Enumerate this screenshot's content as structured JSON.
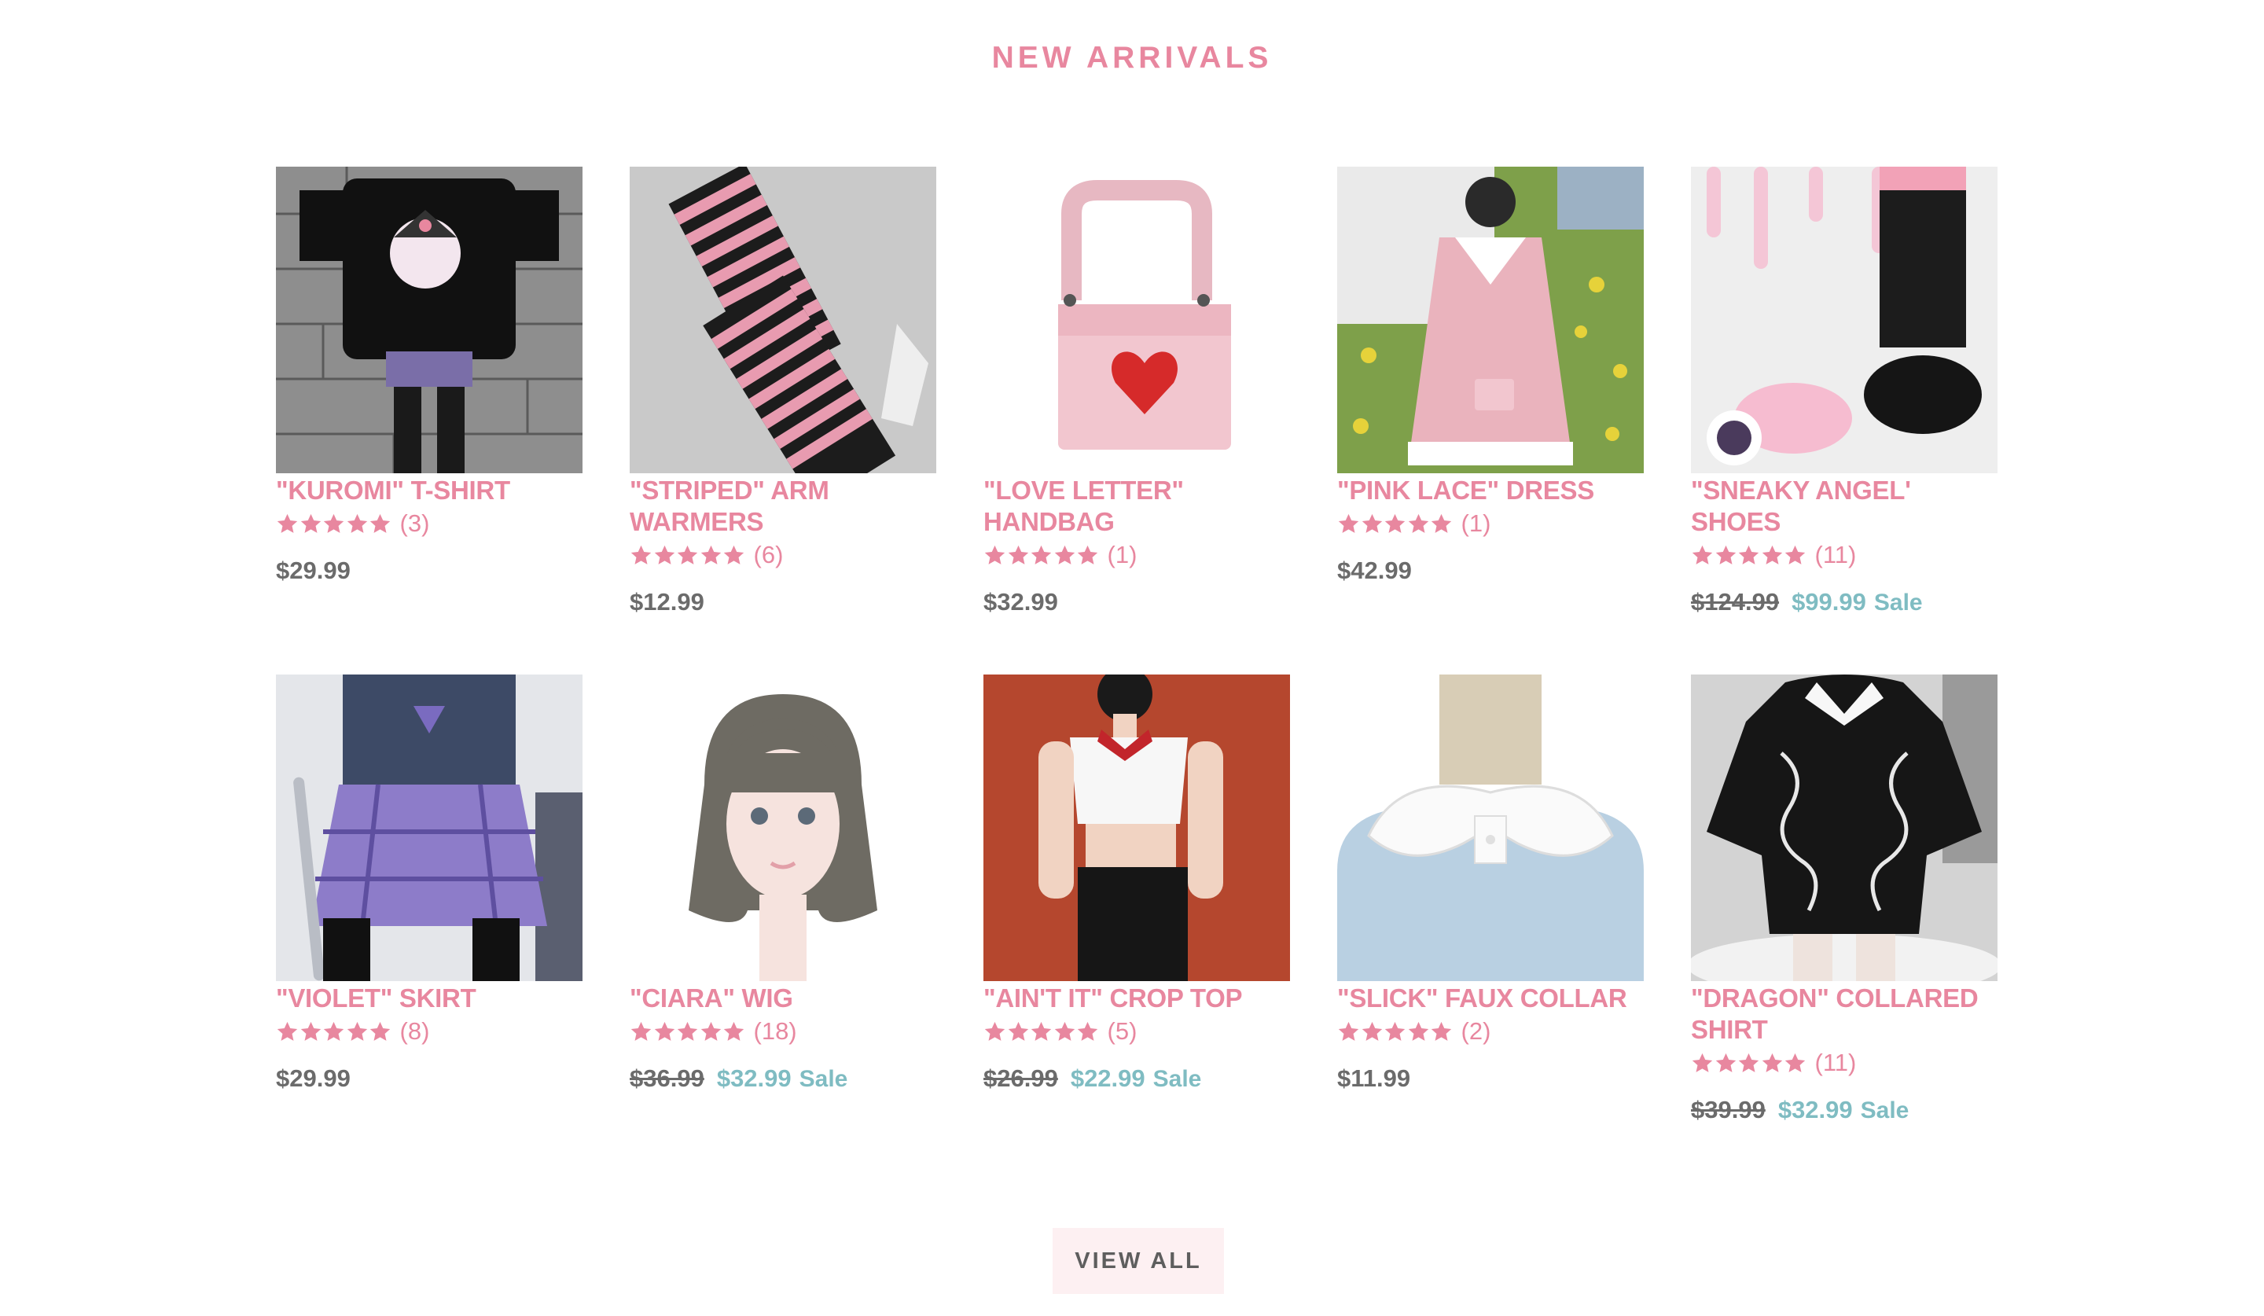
{
  "section": {
    "title": "NEW ARRIVALS",
    "view_all_label": "VIEW ALL"
  },
  "colors": {
    "accent_pink": "#e8879f",
    "sale_teal": "#7fbcc2",
    "price_gray": "#6b6b6b",
    "button_bg": "#fdf0f2"
  },
  "products": [
    {
      "title": "\"KUROMI\" T-SHIRT",
      "rating": 5,
      "reviews": "(3)",
      "price": "$29.99",
      "old_price": "",
      "sale_label": "",
      "image": "kuromi-tshirt-photo"
    },
    {
      "title": "\"STRIPED\" ARM WARMERS",
      "rating": 5,
      "reviews": "(6)",
      "price": "$12.99",
      "old_price": "",
      "sale_label": "",
      "image": "striped-arm-warmers-photo"
    },
    {
      "title": "\"LOVE LETTER\" HANDBAG",
      "rating": 5,
      "reviews": "(1)",
      "price": "$32.99",
      "old_price": "",
      "sale_label": "",
      "image": "love-letter-handbag-photo"
    },
    {
      "title": "\"PINK LACE\" DRESS",
      "rating": 5,
      "reviews": "(1)",
      "price": "$42.99",
      "old_price": "",
      "sale_label": "",
      "image": "pink-lace-dress-photo"
    },
    {
      "title": "\"SNEAKY ANGEL' SHOES",
      "rating": 5,
      "reviews": "(11)",
      "price": "$99.99",
      "old_price": "$124.99",
      "sale_label": "Sale",
      "image": "sneaky-angel-shoes-photo"
    },
    {
      "title": "\"VIOLET\" SKIRT",
      "rating": 5,
      "reviews": "(8)",
      "price": "$29.99",
      "old_price": "",
      "sale_label": "",
      "image": "violet-skirt-photo"
    },
    {
      "title": "\"CIARA\" WIG",
      "rating": 5,
      "reviews": "(18)",
      "price": "$32.99",
      "old_price": "$36.99",
      "sale_label": "Sale",
      "image": "ciara-wig-photo"
    },
    {
      "title": "\"AIN'T IT\" CROP TOP",
      "rating": 5,
      "reviews": "(5)",
      "price": "$22.99",
      "old_price": "$26.99",
      "sale_label": "Sale",
      "image": "aint-it-crop-top-photo"
    },
    {
      "title": "\"SLICK\" FAUX COLLAR",
      "rating": 5,
      "reviews": "(2)",
      "price": "$11.99",
      "old_price": "",
      "sale_label": "",
      "image": "slick-faux-collar-photo"
    },
    {
      "title": "\"DRAGON\" COLLARED SHIRT",
      "rating": 5,
      "reviews": "(11)",
      "price": "$32.99",
      "old_price": "$39.99",
      "sale_label": "Sale",
      "image": "dragon-collared-shirt-photo"
    }
  ]
}
